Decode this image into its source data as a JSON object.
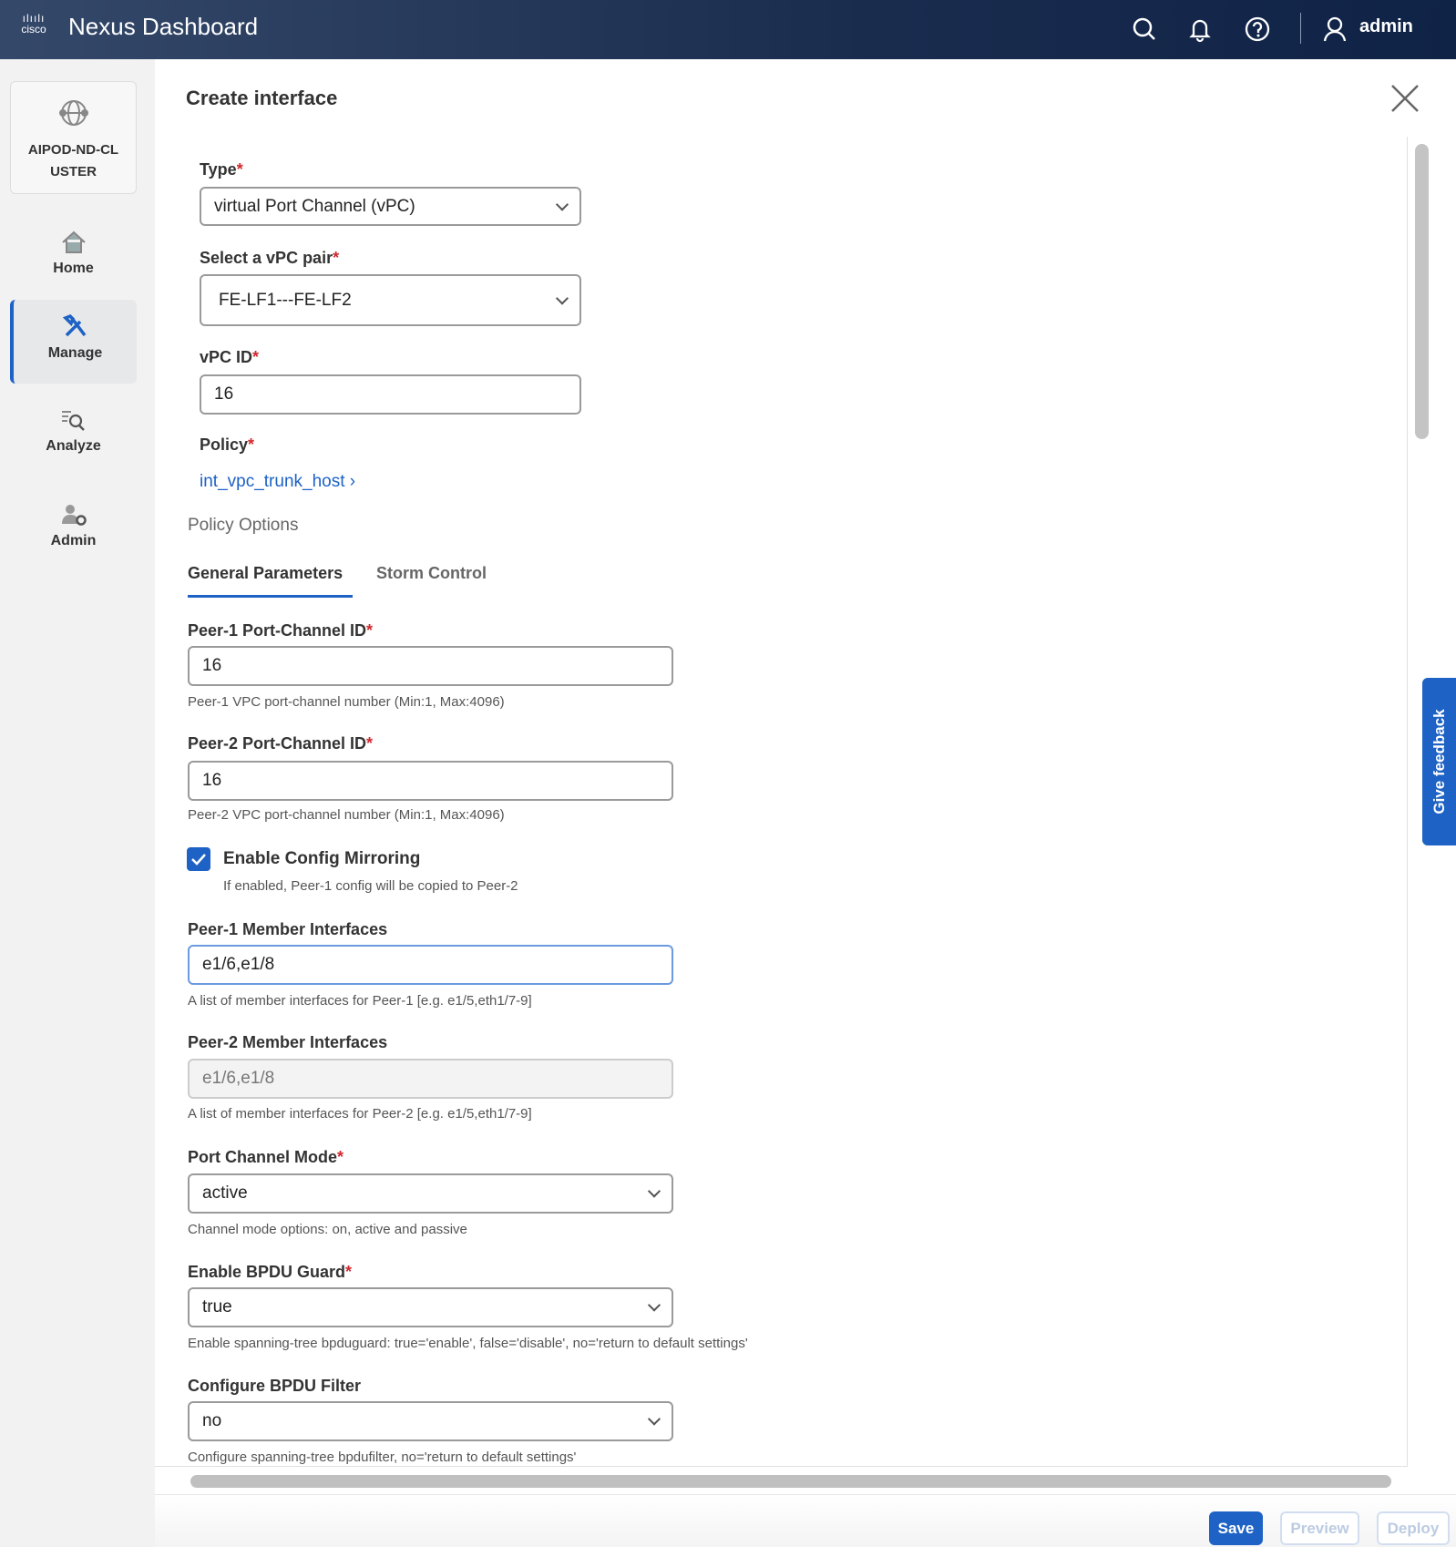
{
  "header": {
    "logo": "cisco",
    "app_title": "Nexus Dashboard",
    "user": "admin",
    "icons": [
      "search-icon",
      "bell-icon",
      "help-icon",
      "user-icon"
    ]
  },
  "sidebar": {
    "cluster": "AIPOD-ND-CLUSTER",
    "cluster_line1": "AIPOD-ND-CL",
    "cluster_line2": "USTER",
    "items": [
      {
        "label": "Home"
      },
      {
        "label": "Manage",
        "active": true
      },
      {
        "label": "Analyze"
      },
      {
        "label": "Admin"
      }
    ]
  },
  "dialog": {
    "title": "Create interface",
    "type": {
      "label": "Type",
      "value": "virtual Port Channel (vPC)"
    },
    "vpc_pair": {
      "label": "Select a vPC pair",
      "value": "FE-LF1---FE-LF2"
    },
    "vpc_id": {
      "label": "vPC ID",
      "value": "16"
    },
    "policy": {
      "label": "Policy",
      "value": "int_vpc_trunk_host"
    },
    "policy_options": "Policy Options",
    "tabs": [
      {
        "label": "General Parameters",
        "active": true
      },
      {
        "label": "Storm Control"
      }
    ],
    "peer1_pc": {
      "label": "Peer-1 Port-Channel ID",
      "value": "16",
      "help": "Peer-1 VPC port-channel number (Min:1, Max:4096)"
    },
    "peer2_pc": {
      "label": "Peer-2 Port-Channel ID",
      "value": "16",
      "help": "Peer-2 VPC port-channel number (Min:1, Max:4096)"
    },
    "mirroring": {
      "label": "Enable Config Mirroring",
      "checked": true,
      "help": "If enabled, Peer-1 config will be copied to Peer-2"
    },
    "peer1_members": {
      "label": "Peer-1 Member Interfaces",
      "value": "e1/6,e1/8",
      "help": "A list of member interfaces for Peer-1 [e.g. e1/5,eth1/7-9]"
    },
    "peer2_members": {
      "label": "Peer-2 Member Interfaces",
      "value": "e1/6,e1/8",
      "help": "A list of member interfaces for Peer-2 [e.g. e1/5,eth1/7-9]"
    },
    "pc_mode": {
      "label": "Port Channel Mode",
      "value": "active",
      "help": "Channel mode options: on, active and passive"
    },
    "bpdu_guard": {
      "label": "Enable BPDU Guard",
      "value": "true",
      "help": "Enable spanning-tree bpduguard: true='enable', false='disable', no='return to default settings'"
    },
    "bpdu_filter": {
      "label": "Configure BPDU Filter",
      "value": "no",
      "help": "Configure spanning-tree bpdufilter, no='return to default settings'"
    }
  },
  "footer": {
    "save": "Save",
    "preview": "Preview",
    "deploy": "Deploy"
  },
  "feedback": "Give feedback",
  "colors": {
    "accent": "#1d62c4",
    "required": "#d0282e",
    "header": "#1a2c4e"
  }
}
